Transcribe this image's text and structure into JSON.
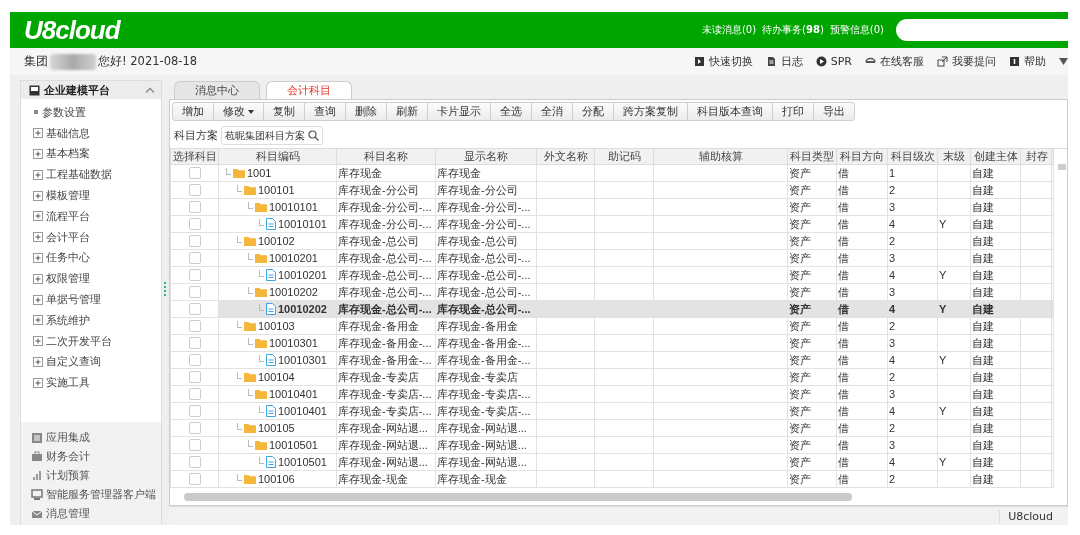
{
  "header": {
    "logo": "U8cloud",
    "notices": [
      "未读消息(0)",
      "待办事务(**98**)",
      "预警信息(0)"
    ]
  },
  "greeting": {
    "group": "集团",
    "text": "您好! 2021-08-18"
  },
  "quick_links": [
    {
      "label": "快速切换"
    },
    {
      "label": "日志"
    },
    {
      "label": "SPR"
    },
    {
      "label": "在线客服"
    },
    {
      "label": "我要提问"
    },
    {
      "label": "帮助"
    }
  ],
  "sidebar": {
    "title": "企业建模平台",
    "expanded": true,
    "items": [
      {
        "label": "参数设置",
        "kind": "leaf"
      },
      {
        "label": "基础信息",
        "kind": "group",
        "expanded": false
      },
      {
        "label": "基本档案",
        "kind": "group",
        "expanded": false
      },
      {
        "label": "工程基础数据",
        "kind": "group",
        "expanded": false
      },
      {
        "label": "模板管理",
        "kind": "group",
        "expanded": false
      },
      {
        "label": "流程平台",
        "kind": "group",
        "expanded": false
      },
      {
        "label": "会计平台",
        "kind": "group",
        "expanded": false
      },
      {
        "label": "任务中心",
        "kind": "group",
        "expanded": false
      },
      {
        "label": "权限管理",
        "kind": "group",
        "expanded": false
      },
      {
        "label": "单据号管理",
        "kind": "group",
        "expanded": false
      },
      {
        "label": "系统维护",
        "kind": "group",
        "expanded": false
      },
      {
        "label": "二次开发平台",
        "kind": "group",
        "expanded": false
      },
      {
        "label": "自定义查询",
        "kind": "group",
        "expanded": false
      },
      {
        "label": "实施工具",
        "kind": "group",
        "expanded": false
      }
    ],
    "modules": [
      {
        "label": "应用集成"
      },
      {
        "label": "财务会计"
      },
      {
        "label": "计划预算"
      },
      {
        "label": "智能服务管理器客户端"
      },
      {
        "label": "消息管理"
      }
    ]
  },
  "tabs": [
    {
      "label": "消息中心",
      "selected": false
    },
    {
      "label": "会计科目",
      "selected": true
    }
  ],
  "toolbar": [
    {
      "label": "增加",
      "dropdown": false
    },
    {
      "label": "修改",
      "dropdown": true
    },
    {
      "label": "复制",
      "dropdown": false
    },
    {
      "label": "查询",
      "dropdown": false
    },
    {
      "label": "删除",
      "dropdown": false
    },
    {
      "label": "刷新",
      "dropdown": false
    },
    {
      "label": "卡片显示",
      "dropdown": false
    },
    {
      "label": "全选",
      "dropdown": false
    },
    {
      "label": "全消",
      "dropdown": false
    },
    {
      "label": "分配",
      "dropdown": false
    },
    {
      "label": "跨方案复制",
      "dropdown": false
    },
    {
      "label": "科目版本查询",
      "dropdown": false
    },
    {
      "label": "打印",
      "dropdown": false
    },
    {
      "label": "导出",
      "dropdown": false
    }
  ],
  "scheme": {
    "label": "科目方案",
    "value": "苞昵集团科目方案"
  },
  "table": {
    "columns": [
      "选择科目",
      "科目编码",
      "科目名称",
      "显示名称",
      "外文名称",
      "助记码",
      "辅助核算",
      "科目类型",
      "科目方向",
      "科目级次",
      "末级",
      "创建主体",
      "封存"
    ],
    "rows": [
      {
        "code": "1001",
        "kind": "folder",
        "name": "库存现金",
        "display_name": "库存现金",
        "type": "资产",
        "direction": "借",
        "grade": "1",
        "creator": "自建",
        "checked": false,
        "selected": false,
        "children": [
          {
            "code": "100101",
            "kind": "folder",
            "name": "库存现金-分公司",
            "display_name": "库存现金-分公司",
            "type": "资产",
            "direction": "借",
            "grade": "2",
            "creator": "自建",
            "checked": false,
            "selected": false,
            "children": [
              {
                "code": "10010101",
                "kind": "folder",
                "name": "库存现金-分公司-...",
                "display_name": "库存现金-分公司-...",
                "type": "资产",
                "direction": "借",
                "grade": "3",
                "creator": "自建",
                "checked": false,
                "selected": false,
                "children": [
                  {
                    "code": "10010101",
                    "kind": "file",
                    "name": "库存现金-分公司-...",
                    "display_name": "库存现金-分公司-...",
                    "type": "资产",
                    "direction": "借",
                    "grade": "4",
                    "last_level": "Y",
                    "creator": "自建",
                    "checked": false,
                    "selected": false
                  }
                ]
              }
            ]
          },
          {
            "code": "100102",
            "kind": "folder",
            "name": "库存现金-总公司",
            "display_name": "库存现金-总公司",
            "type": "资产",
            "direction": "借",
            "grade": "2",
            "creator": "自建",
            "checked": false,
            "selected": false,
            "children": [
              {
                "code": "10010201",
                "kind": "folder",
                "name": "库存现金-总公司-...",
                "display_name": "库存现金-总公司-...",
                "type": "资产",
                "direction": "借",
                "grade": "3",
                "creator": "自建",
                "checked": false,
                "selected": false,
                "children": [
                  {
                    "code": "10010201",
                    "kind": "file",
                    "name": "库存现金-总公司-...",
                    "display_name": "库存现金-总公司-...",
                    "type": "资产",
                    "direction": "借",
                    "grade": "4",
                    "last_level": "Y",
                    "creator": "自建",
                    "checked": false,
                    "selected": false
                  }
                ]
              },
              {
                "code": "10010202",
                "kind": "folder",
                "name": "库存现金-总公司-...",
                "display_name": "库存现金-总公司-...",
                "type": "资产",
                "direction": "借",
                "grade": "3",
                "creator": "自建",
                "checked": false,
                "selected": false,
                "children": [
                  {
                    "code": "10010202",
                    "kind": "file",
                    "name": "库存现金-总公司-...",
                    "display_name": "库存现金-总公司-...",
                    "type": "资产",
                    "direction": "借",
                    "grade": "4",
                    "last_level": "Y",
                    "creator": "自建",
                    "checked": false,
                    "selected": true
                  }
                ]
              }
            ]
          },
          {
            "code": "100103",
            "kind": "folder",
            "name": "库存现金-备用金",
            "display_name": "库存现金-备用金",
            "type": "资产",
            "direction": "借",
            "grade": "2",
            "creator": "自建",
            "checked": false,
            "selected": false,
            "children": [
              {
                "code": "10010301",
                "kind": "folder",
                "name": "库存现金-备用金-...",
                "display_name": "库存现金-备用金-...",
                "type": "资产",
                "direction": "借",
                "grade": "3",
                "creator": "自建",
                "checked": false,
                "selected": false,
                "children": [
                  {
                    "code": "10010301",
                    "kind": "file",
                    "name": "库存现金-备用金-...",
                    "display_name": "库存现金-备用金-...",
                    "type": "资产",
                    "direction": "借",
                    "grade": "4",
                    "last_level": "Y",
                    "creator": "自建",
                    "checked": false,
                    "selected": false
                  }
                ]
              }
            ]
          },
          {
            "code": "100104",
            "kind": "folder",
            "name": "库存现金-专卖店",
            "display_name": "库存现金-专卖店",
            "type": "资产",
            "direction": "借",
            "grade": "2",
            "creator": "自建",
            "checked": false,
            "selected": false,
            "children": [
              {
                "code": "10010401",
                "kind": "folder",
                "name": "库存现金-专卖店-...",
                "display_name": "库存现金-专卖店-...",
                "type": "资产",
                "direction": "借",
                "grade": "3",
                "creator": "自建",
                "checked": false,
                "selected": false,
                "children": [
                  {
                    "code": "10010401",
                    "kind": "file",
                    "name": "库存现金-专卖店-...",
                    "display_name": "库存现金-专卖店-...",
                    "type": "资产",
                    "direction": "借",
                    "grade": "4",
                    "last_level": "Y",
                    "creator": "自建",
                    "checked": false,
                    "selected": false
                  }
                ]
              }
            ]
          },
          {
            "code": "100105",
            "kind": "folder",
            "name": "库存现金-网站退...",
            "display_name": "库存现金-网站退...",
            "type": "资产",
            "direction": "借",
            "grade": "2",
            "creator": "自建",
            "checked": false,
            "selected": false,
            "children": [
              {
                "code": "10010501",
                "kind": "folder",
                "name": "库存现金-网站退...",
                "display_name": "库存现金-网站退...",
                "type": "资产",
                "direction": "借",
                "grade": "3",
                "creator": "自建",
                "checked": false,
                "selected": false,
                "children": [
                  {
                    "code": "10010501",
                    "kind": "file",
                    "name": "库存现金-网站退...",
                    "display_name": "库存现金-网站退...",
                    "type": "资产",
                    "direction": "借",
                    "grade": "4",
                    "last_level": "Y",
                    "creator": "自建",
                    "checked": false,
                    "selected": false
                  }
                ]
              }
            ]
          },
          {
            "code": "100106",
            "kind": "folder",
            "name": "库存现金-现金",
            "display_name": "库存现金-现金",
            "type": "资产",
            "direction": "借",
            "grade": "2",
            "creator": "自建",
            "checked": false,
            "selected": false
          }
        ]
      }
    ]
  },
  "status_bar": {
    "text": "U8cloud"
  }
}
